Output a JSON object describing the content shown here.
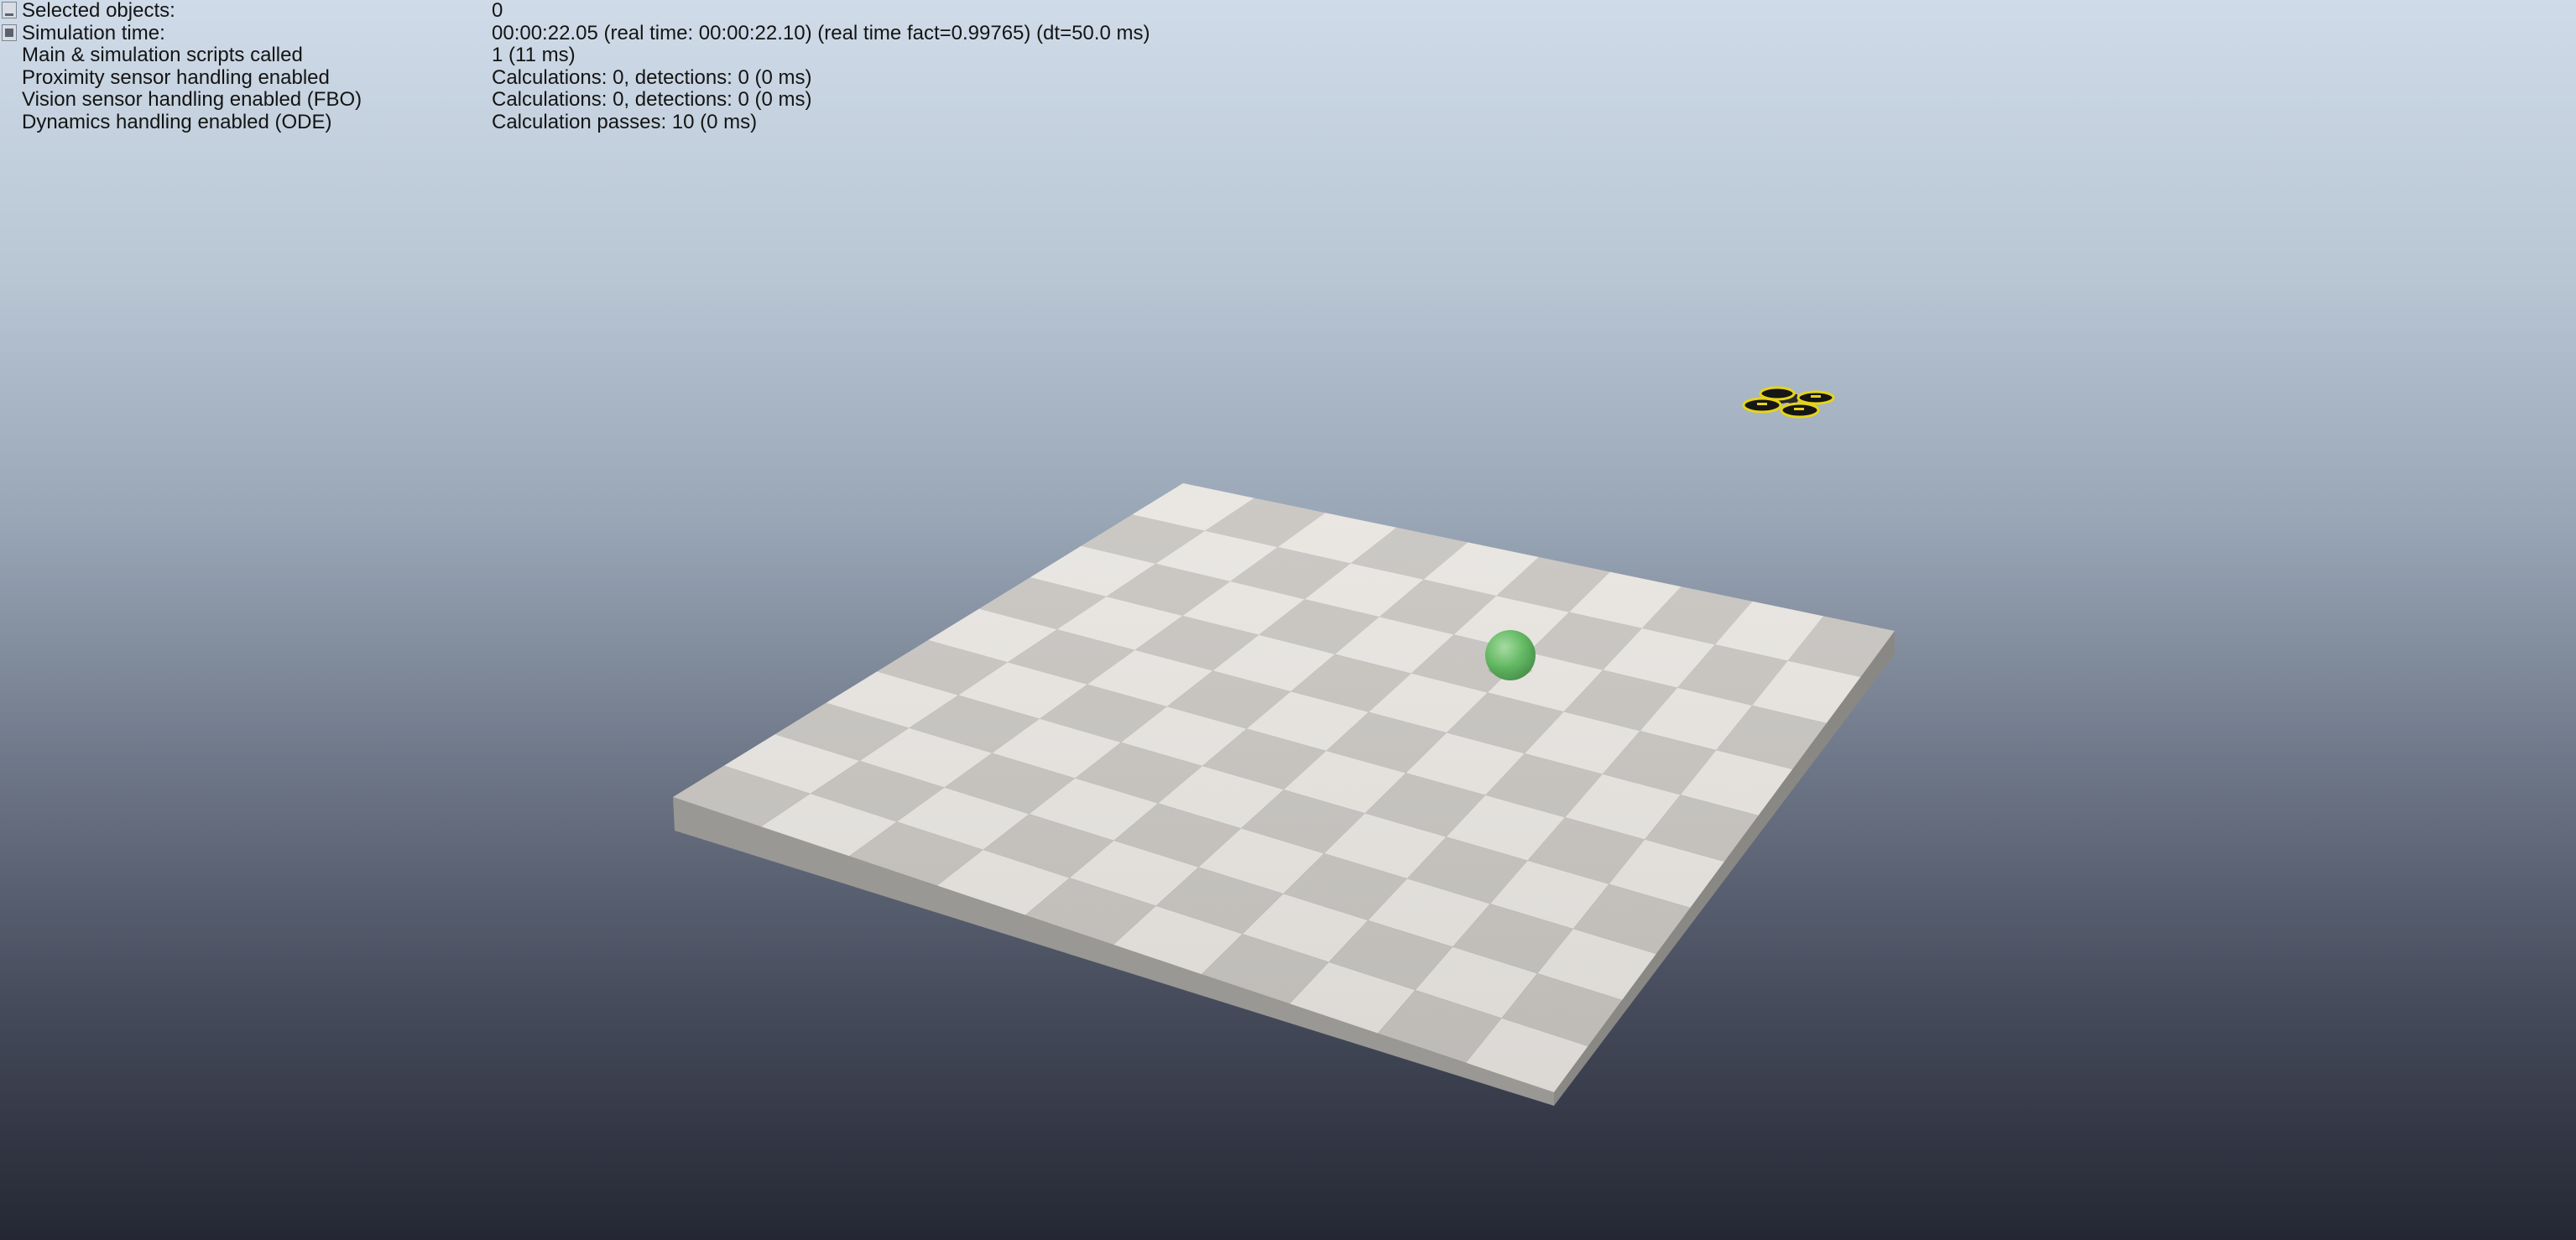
{
  "info_overlay": {
    "rows": [
      {
        "label": "Selected objects:",
        "value": "0"
      },
      {
        "label": "Simulation time:",
        "value": "00:00:22.05 (real time: 00:00:22.10) (real time fact=0.99765) (dt=50.0 ms)"
      },
      {
        "label": "Main & simulation scripts called",
        "value": "1 (11 ms)"
      },
      {
        "label": "Proximity sensor handling enabled",
        "value": "Calculations: 0, detections: 0 (0 ms)"
      },
      {
        "label": "Vision sensor handling enabled (FBO)",
        "value": "Calculations: 0, detections: 0 (0 ms)"
      },
      {
        "label": "Dynamics handling enabled (ODE)",
        "value": "Calculation passes: 10 (0 ms)"
      }
    ]
  },
  "scene": {
    "floor": {
      "grid_cells": 10,
      "light_tile_color": "#e9e6e2",
      "dark_tile_color": "#c9c6c2"
    },
    "target_sphere": {
      "color": "#5cb85c"
    },
    "quadcopter": {
      "accent_color": "#e6d41a"
    }
  }
}
